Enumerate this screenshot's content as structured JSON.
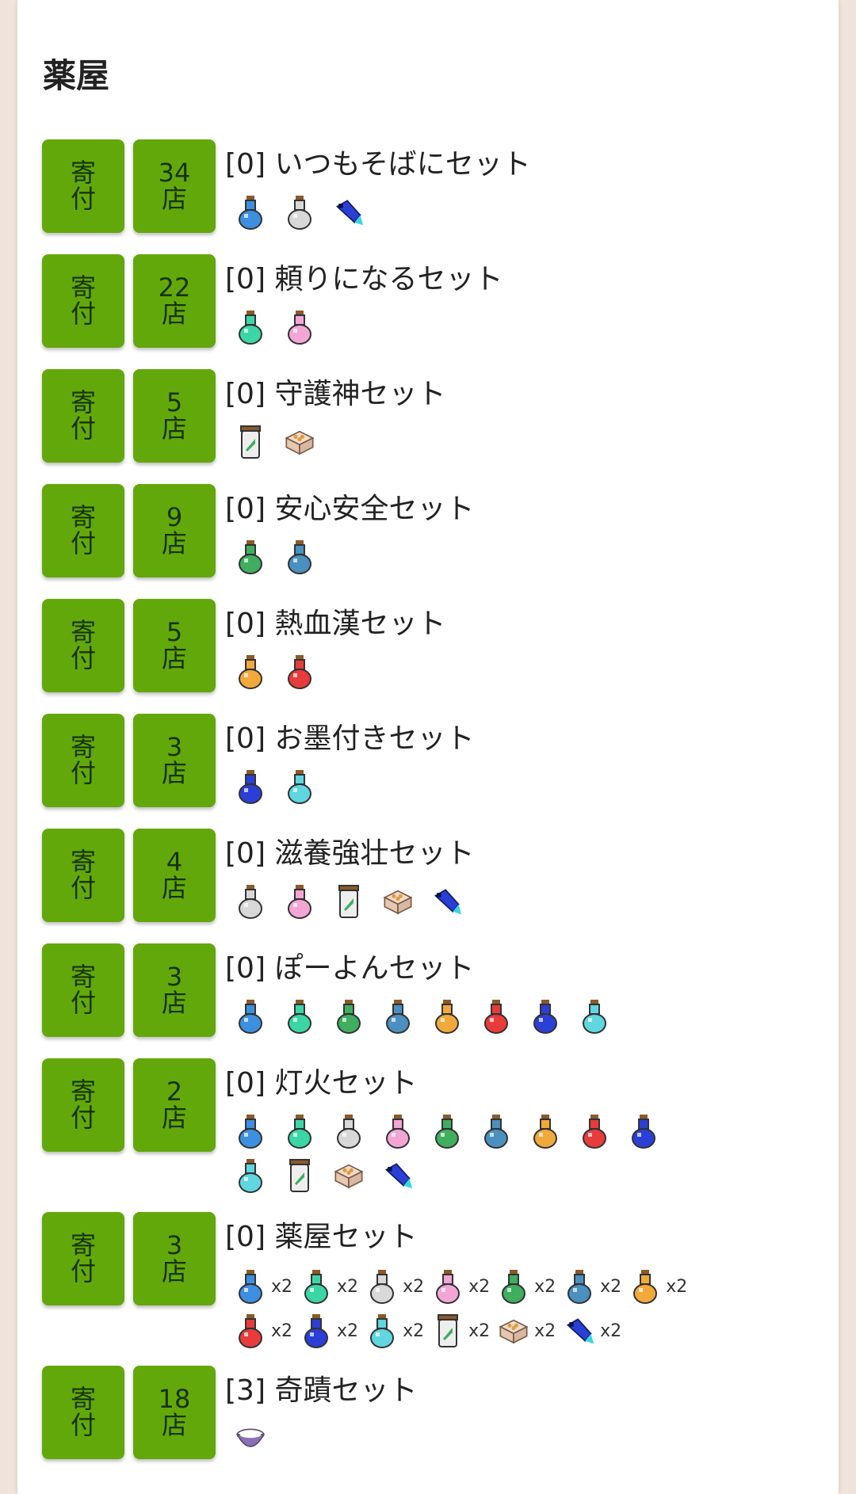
{
  "page_title": "薬屋",
  "donate_label": "寄\n付",
  "bundles": [
    {
      "name": "[0] いつもそばにセット",
      "stores": "34\n店",
      "items": [
        {
          "icon": "potion-blue-icon"
        },
        {
          "icon": "potion-white-icon"
        },
        {
          "icon": "brush-icon"
        }
      ]
    },
    {
      "name": "[0] 頼りになるセット",
      "stores": "22\n店",
      "items": [
        {
          "icon": "potion-teal-icon"
        },
        {
          "icon": "potion-pink-icon"
        }
      ]
    },
    {
      "name": "[0] 守護神セット",
      "stores": "5\n店",
      "items": [
        {
          "icon": "jar-icon"
        },
        {
          "icon": "crate-icon"
        }
      ]
    },
    {
      "name": "[0] 安心安全セット",
      "stores": "9\n店",
      "items": [
        {
          "icon": "potion-green-icon"
        },
        {
          "icon": "potion-steelblue-icon"
        }
      ]
    },
    {
      "name": "[0] 熱血漢セット",
      "stores": "5\n店",
      "items": [
        {
          "icon": "potion-orange-icon"
        },
        {
          "icon": "potion-red-icon"
        }
      ]
    },
    {
      "name": "[0] お墨付きセット",
      "stores": "3\n店",
      "items": [
        {
          "icon": "potion-indigo-icon"
        },
        {
          "icon": "potion-cyan-icon"
        }
      ]
    },
    {
      "name": "[0] 滋養強壮セット",
      "stores": "4\n店",
      "items": [
        {
          "icon": "potion-white-icon"
        },
        {
          "icon": "potion-pink-icon"
        },
        {
          "icon": "jar-icon"
        },
        {
          "icon": "crate-icon"
        },
        {
          "icon": "brush-icon"
        }
      ]
    },
    {
      "name": "[0] ぽーよんセット",
      "stores": "3\n店",
      "items": [
        {
          "icon": "potion-blue-icon"
        },
        {
          "icon": "potion-teal-icon"
        },
        {
          "icon": "potion-green-icon"
        },
        {
          "icon": "potion-steelblue-icon"
        },
        {
          "icon": "potion-orange-icon"
        },
        {
          "icon": "potion-red-icon"
        },
        {
          "icon": "potion-indigo-icon"
        },
        {
          "icon": "potion-cyan-icon"
        }
      ]
    },
    {
      "name": "[0] 灯火セット",
      "stores": "2\n店",
      "items": [
        {
          "icon": "potion-blue-icon"
        },
        {
          "icon": "potion-teal-icon"
        },
        {
          "icon": "potion-white-icon"
        },
        {
          "icon": "potion-pink-icon"
        },
        {
          "icon": "potion-green-icon"
        },
        {
          "icon": "potion-steelblue-icon"
        },
        {
          "icon": "potion-orange-icon"
        },
        {
          "icon": "potion-red-icon"
        },
        {
          "icon": "potion-indigo-icon"
        },
        {
          "icon": "potion-cyan-icon"
        },
        {
          "icon": "jar-icon"
        },
        {
          "icon": "crate-icon"
        },
        {
          "icon": "brush-icon"
        }
      ]
    },
    {
      "name": "[0] 薬屋セット",
      "stores": "3\n店",
      "items": [
        {
          "icon": "potion-blue-icon",
          "qty": "x2"
        },
        {
          "icon": "potion-teal-icon",
          "qty": "x2"
        },
        {
          "icon": "potion-white-icon",
          "qty": "x2"
        },
        {
          "icon": "potion-pink-icon",
          "qty": "x2"
        },
        {
          "icon": "potion-green-icon",
          "qty": "x2"
        },
        {
          "icon": "potion-steelblue-icon",
          "qty": "x2"
        },
        {
          "icon": "potion-orange-icon",
          "qty": "x2"
        },
        {
          "icon": "potion-red-icon",
          "qty": "x2"
        },
        {
          "icon": "potion-indigo-icon",
          "qty": "x2"
        },
        {
          "icon": "potion-cyan-icon",
          "qty": "x2"
        },
        {
          "icon": "jar-icon",
          "qty": "x2"
        },
        {
          "icon": "crate-icon",
          "qty": "x2"
        },
        {
          "icon": "brush-icon",
          "qty": "x2"
        }
      ]
    },
    {
      "name": "[3] 奇蹟セット",
      "stores": "18\n店",
      "items": [
        {
          "icon": "bowl-icon"
        }
      ]
    }
  ],
  "icon_colors": {
    "potion-blue-icon": "#3d8fe0",
    "potion-white-icon": "#d8d8d8",
    "potion-teal-icon": "#3cd6a6",
    "potion-pink-icon": "#f3a6d6",
    "potion-green-icon": "#3fae5e",
    "potion-steelblue-icon": "#4a90c0",
    "potion-orange-icon": "#f2a93b",
    "potion-red-icon": "#e83b3b",
    "potion-indigo-icon": "#2b3fd6",
    "potion-cyan-icon": "#5fd6e0"
  },
  "accent_color": "#63a80a"
}
